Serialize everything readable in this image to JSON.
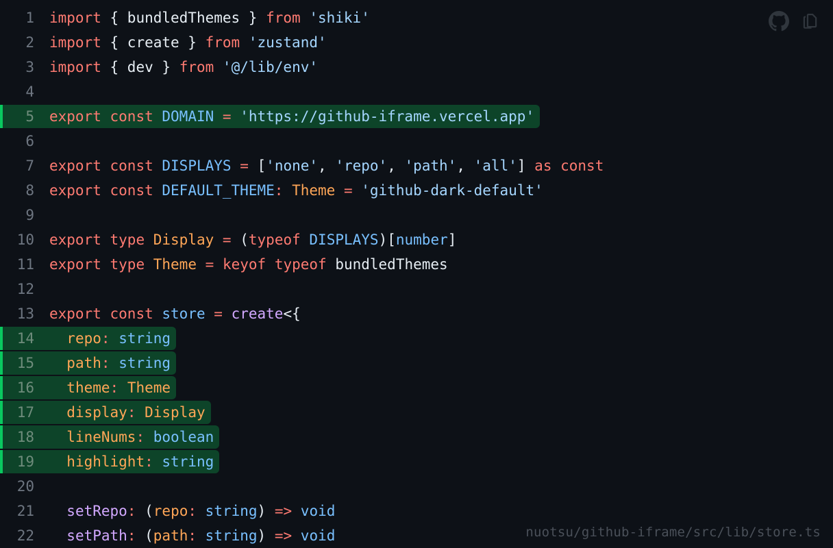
{
  "viewer": {
    "background": "#0d1117",
    "highlight_bg": "#0d4429",
    "highlight_bar": "#09c85f",
    "watermark": "nuotsu/github-iframe/src/lib/store.ts",
    "theme_name": "github-dark-default"
  },
  "actions": [
    {
      "name": "github-icon",
      "label": "GitHub"
    },
    {
      "name": "copy-icon",
      "label": "Copy"
    }
  ],
  "code": {
    "lines": [
      {
        "num": "1",
        "highlight": false,
        "text": "import { bundledThemes } from 'shiki'"
      },
      {
        "num": "2",
        "highlight": false,
        "text": "import { create } from 'zustand'"
      },
      {
        "num": "3",
        "highlight": false,
        "text": "import { dev } from '@/lib/env'"
      },
      {
        "num": "4",
        "highlight": false,
        "text": ""
      },
      {
        "num": "5",
        "highlight": true,
        "text": "export const DOMAIN = 'https://github-iframe.vercel.app'"
      },
      {
        "num": "6",
        "highlight": false,
        "text": ""
      },
      {
        "num": "7",
        "highlight": false,
        "text": "export const DISPLAYS = ['none', 'repo', 'path', 'all'] as const"
      },
      {
        "num": "8",
        "highlight": false,
        "text": "export const DEFAULT_THEME: Theme = 'github-dark-default'"
      },
      {
        "num": "9",
        "highlight": false,
        "text": ""
      },
      {
        "num": "10",
        "highlight": false,
        "text": "export type Display = (typeof DISPLAYS)[number]"
      },
      {
        "num": "11",
        "highlight": false,
        "text": "export type Theme = keyof typeof bundledThemes"
      },
      {
        "num": "12",
        "highlight": false,
        "text": ""
      },
      {
        "num": "13",
        "highlight": false,
        "text": "export const store = create<{"
      },
      {
        "num": "14",
        "highlight": true,
        "text": "\trepo: string"
      },
      {
        "num": "15",
        "highlight": true,
        "text": "\tpath: string"
      },
      {
        "num": "16",
        "highlight": true,
        "text": "\ttheme: Theme"
      },
      {
        "num": "17",
        "highlight": true,
        "text": "\tdisplay: Display"
      },
      {
        "num": "18",
        "highlight": true,
        "text": "\tlineNums: boolean"
      },
      {
        "num": "19",
        "highlight": true,
        "text": "\thighlight: string"
      },
      {
        "num": "20",
        "highlight": false,
        "text": ""
      },
      {
        "num": "21",
        "highlight": false,
        "text": "\tsetRepo: (repo: string) => void"
      },
      {
        "num": "22",
        "highlight": false,
        "text": "\tsetPath: (path: string) => void"
      }
    ],
    "tokens": [
      [
        [
          "import",
          "kw"
        ],
        [
          " ",
          "plain"
        ],
        [
          "{ bundledThemes }",
          "plain"
        ],
        [
          " ",
          "plain"
        ],
        [
          "from",
          "kw"
        ],
        [
          " ",
          "plain"
        ],
        [
          "'shiki'",
          "str"
        ]
      ],
      [
        [
          "import",
          "kw"
        ],
        [
          " ",
          "plain"
        ],
        [
          "{ create }",
          "plain"
        ],
        [
          " ",
          "plain"
        ],
        [
          "from",
          "kw"
        ],
        [
          " ",
          "plain"
        ],
        [
          "'zustand'",
          "str"
        ]
      ],
      [
        [
          "import",
          "kw"
        ],
        [
          " ",
          "plain"
        ],
        [
          "{ dev }",
          "plain"
        ],
        [
          " ",
          "plain"
        ],
        [
          "from",
          "kw"
        ],
        [
          " ",
          "plain"
        ],
        [
          "'@/lib/env'",
          "str"
        ]
      ],
      [],
      [
        [
          "export",
          "kw"
        ],
        [
          " ",
          "plain"
        ],
        [
          "const",
          "kw"
        ],
        [
          " ",
          "plain"
        ],
        [
          "DOMAIN",
          "var"
        ],
        [
          " ",
          "plain"
        ],
        [
          "=",
          "punc"
        ],
        [
          " ",
          "plain"
        ],
        [
          "'https://github-iframe.vercel.app'",
          "str"
        ]
      ],
      [],
      [
        [
          "export",
          "kw"
        ],
        [
          " ",
          "plain"
        ],
        [
          "const",
          "kw"
        ],
        [
          " ",
          "plain"
        ],
        [
          "DISPLAYS",
          "var"
        ],
        [
          " ",
          "plain"
        ],
        [
          "=",
          "punc"
        ],
        [
          " ",
          "plain"
        ],
        [
          "[",
          "plain"
        ],
        [
          "'none'",
          "str"
        ],
        [
          ", ",
          "plain"
        ],
        [
          "'repo'",
          "str"
        ],
        [
          ", ",
          "plain"
        ],
        [
          "'path'",
          "str"
        ],
        [
          ", ",
          "plain"
        ],
        [
          "'all'",
          "str"
        ],
        [
          "]",
          "plain"
        ],
        [
          " ",
          "plain"
        ],
        [
          "as",
          "kw"
        ],
        [
          " ",
          "plain"
        ],
        [
          "const",
          "kw"
        ]
      ],
      [
        [
          "export",
          "kw"
        ],
        [
          " ",
          "plain"
        ],
        [
          "const",
          "kw"
        ],
        [
          " ",
          "plain"
        ],
        [
          "DEFAULT_THEME",
          "var"
        ],
        [
          ":",
          "punc"
        ],
        [
          " ",
          "plain"
        ],
        [
          "Theme",
          "type"
        ],
        [
          " ",
          "plain"
        ],
        [
          "=",
          "punc"
        ],
        [
          " ",
          "plain"
        ],
        [
          "'github-dark-default'",
          "str"
        ]
      ],
      [],
      [
        [
          "export",
          "kw"
        ],
        [
          " ",
          "plain"
        ],
        [
          "type",
          "kw"
        ],
        [
          " ",
          "plain"
        ],
        [
          "Display",
          "type"
        ],
        [
          " ",
          "plain"
        ],
        [
          "=",
          "punc"
        ],
        [
          " ",
          "plain"
        ],
        [
          "(",
          "plain"
        ],
        [
          "typeof",
          "kw"
        ],
        [
          " ",
          "plain"
        ],
        [
          "DISPLAYS",
          "var"
        ],
        [
          ")",
          "plain"
        ],
        [
          "[",
          "plain"
        ],
        [
          "number",
          "var"
        ],
        [
          "]",
          "plain"
        ]
      ],
      [
        [
          "export",
          "kw"
        ],
        [
          " ",
          "plain"
        ],
        [
          "type",
          "kw"
        ],
        [
          " ",
          "plain"
        ],
        [
          "Theme",
          "type"
        ],
        [
          " ",
          "plain"
        ],
        [
          "=",
          "punc"
        ],
        [
          " ",
          "plain"
        ],
        [
          "keyof",
          "kw"
        ],
        [
          " ",
          "plain"
        ],
        [
          "typeof",
          "kw"
        ],
        [
          " ",
          "plain"
        ],
        [
          "bundledThemes",
          "plain"
        ]
      ],
      [],
      [
        [
          "export",
          "kw"
        ],
        [
          " ",
          "plain"
        ],
        [
          "const",
          "kw"
        ],
        [
          " ",
          "plain"
        ],
        [
          "store",
          "var"
        ],
        [
          " ",
          "plain"
        ],
        [
          "=",
          "punc"
        ],
        [
          " ",
          "plain"
        ],
        [
          "create",
          "fn"
        ],
        [
          "<{",
          "plain"
        ]
      ],
      [
        [
          "  ",
          "plain"
        ],
        [
          "repo",
          "type"
        ],
        [
          ":",
          "punc"
        ],
        [
          " ",
          "plain"
        ],
        [
          "string",
          "var"
        ]
      ],
      [
        [
          "  ",
          "plain"
        ],
        [
          "path",
          "type"
        ],
        [
          ":",
          "punc"
        ],
        [
          " ",
          "plain"
        ],
        [
          "string",
          "var"
        ]
      ],
      [
        [
          "  ",
          "plain"
        ],
        [
          "theme",
          "type"
        ],
        [
          ":",
          "punc"
        ],
        [
          " ",
          "plain"
        ],
        [
          "Theme",
          "type"
        ]
      ],
      [
        [
          "  ",
          "plain"
        ],
        [
          "display",
          "type"
        ],
        [
          ":",
          "punc"
        ],
        [
          " ",
          "plain"
        ],
        [
          "Display",
          "type"
        ]
      ],
      [
        [
          "  ",
          "plain"
        ],
        [
          "lineNums",
          "type"
        ],
        [
          ":",
          "punc"
        ],
        [
          " ",
          "plain"
        ],
        [
          "boolean",
          "var"
        ]
      ],
      [
        [
          "  ",
          "plain"
        ],
        [
          "highlight",
          "type"
        ],
        [
          ":",
          "punc"
        ],
        [
          " ",
          "plain"
        ],
        [
          "string",
          "var"
        ]
      ],
      [],
      [
        [
          "  ",
          "plain"
        ],
        [
          "setRepo",
          "fn"
        ],
        [
          ":",
          "punc"
        ],
        [
          " ",
          "plain"
        ],
        [
          "(",
          "plain"
        ],
        [
          "repo",
          "type"
        ],
        [
          ":",
          "punc"
        ],
        [
          " ",
          "plain"
        ],
        [
          "string",
          "var"
        ],
        [
          ")",
          "plain"
        ],
        [
          " ",
          "plain"
        ],
        [
          "=>",
          "kw"
        ],
        [
          " ",
          "plain"
        ],
        [
          "void",
          "var"
        ]
      ],
      [
        [
          "  ",
          "plain"
        ],
        [
          "setPath",
          "fn"
        ],
        [
          ":",
          "punc"
        ],
        [
          " ",
          "plain"
        ],
        [
          "(",
          "plain"
        ],
        [
          "path",
          "type"
        ],
        [
          ":",
          "punc"
        ],
        [
          " ",
          "plain"
        ],
        [
          "string",
          "var"
        ],
        [
          ")",
          "plain"
        ],
        [
          " ",
          "plain"
        ],
        [
          "=>",
          "kw"
        ],
        [
          " ",
          "plain"
        ],
        [
          "void",
          "var"
        ]
      ]
    ]
  }
}
